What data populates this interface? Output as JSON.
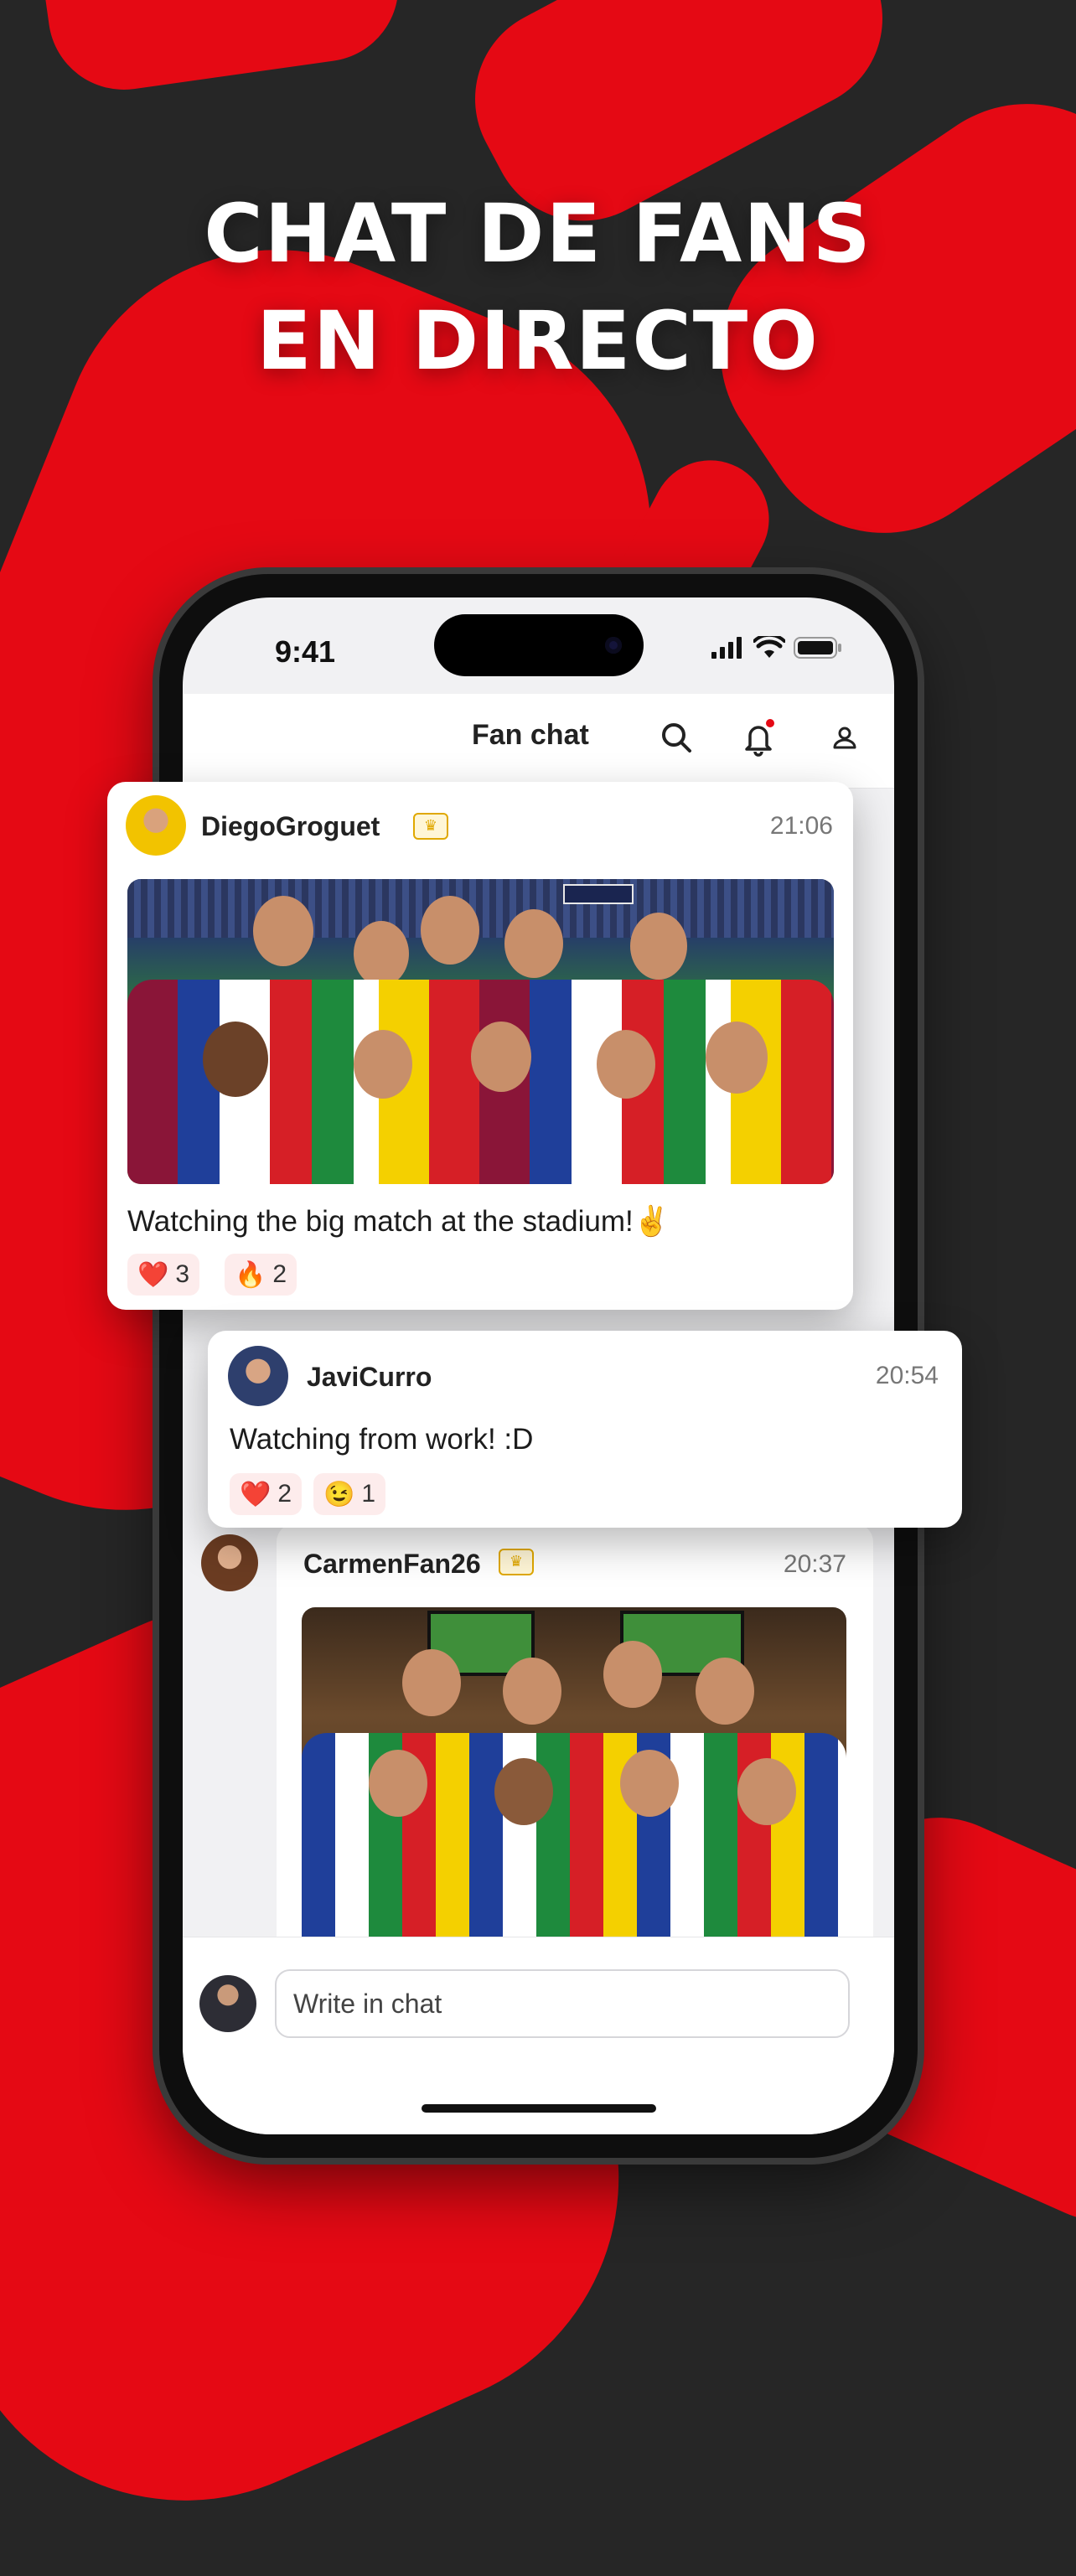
{
  "headline": {
    "line1": "CHAT DE FANS",
    "line2": "EN DIRECTO"
  },
  "status_bar": {
    "time": "9:41"
  },
  "header": {
    "title": "Fan chat"
  },
  "icons": {
    "search": "search-icon",
    "bell": "bell-icon",
    "profile": "user-icon",
    "crown": "crown-icon"
  },
  "messages": [
    {
      "user": "DiegoGroguet",
      "time": "21:06",
      "text": "Watching the big match at the stadium!✌️",
      "has_photo": true,
      "reactions": [
        {
          "emoji": "❤️",
          "count": "3"
        },
        {
          "emoji": "🔥",
          "count": "2"
        }
      ]
    },
    {
      "user": "JaviCurro",
      "time": "20:54",
      "text": "Watching from work! :D",
      "has_photo": false,
      "reactions": [
        {
          "emoji": "❤️",
          "count": "2"
        },
        {
          "emoji": "😉",
          "count": "1"
        }
      ]
    },
    {
      "user": "CarmenFan26",
      "time": "20:37",
      "has_photo": true
    }
  ],
  "composer": {
    "placeholder": "Write in chat"
  },
  "colors": {
    "accent": "#e50914",
    "background": "#262626",
    "crown": "#e0a800"
  }
}
